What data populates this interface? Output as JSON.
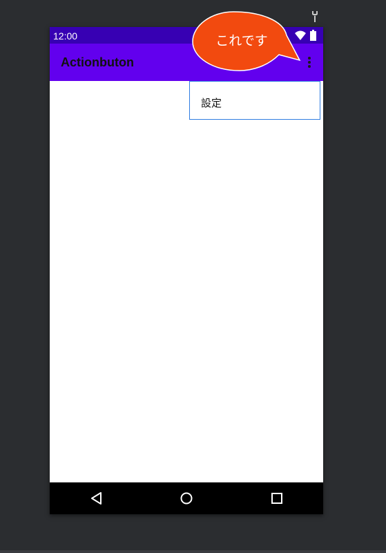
{
  "status_bar": {
    "time": "12:00"
  },
  "app_bar": {
    "title": "Actionbuton"
  },
  "overflow_menu": {
    "items": [
      {
        "label": "設定"
      }
    ]
  },
  "callout": {
    "text": "これです"
  },
  "colors": {
    "status_bar": "#3700b3",
    "app_bar": "#6200ee",
    "callout_fill": "#f24a0f",
    "menu_border": "#2f7de1",
    "background": "#2b2d30"
  },
  "icons": [
    "wrench-icon",
    "wifi-icon",
    "battery-icon",
    "more-vert-icon",
    "back-icon",
    "home-icon",
    "recents-icon"
  ]
}
